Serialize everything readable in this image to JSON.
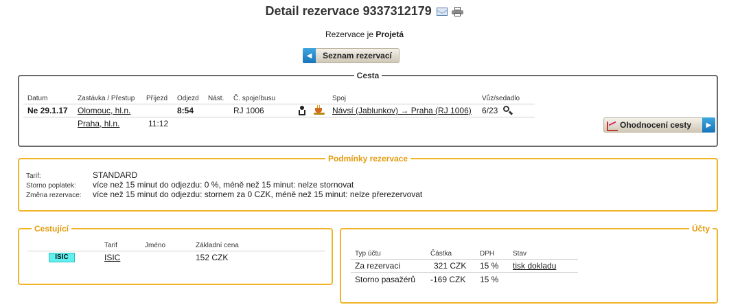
{
  "header": {
    "title": "Detail rezervace 9337312179",
    "mail_icon": "mail-icon",
    "print_icon": "print-icon"
  },
  "status": {
    "prefix": "Rezervace je",
    "value": "Projetá"
  },
  "buttons": {
    "list_label": "Seznam rezervací",
    "rating_label": "Ohodnocení cesty"
  },
  "cesta": {
    "legend": "Cesta",
    "headers": {
      "datum": "Datum",
      "zastavka": "Zastávka / Přestup",
      "prijezd": "Příjezd",
      "odjezd": "Odjezd",
      "nast": "Nást.",
      "spoj_cislo": "Č. spoje/busu",
      "spoj": "Spoj",
      "vuz": "Vůz/sedadlo"
    },
    "rows": [
      {
        "datum": "Ne 29.1.17",
        "zastavka": "Olomouc, hl.n.",
        "prijezd": "",
        "odjezd": "8:54",
        "nast": "",
        "spoj_cislo": "RJ 1006",
        "spoj": "Návsí (Jablunkov) → Praha (RJ 1006)",
        "vuz": "6/23"
      },
      {
        "datum": "",
        "zastavka": "Praha, hl.n.",
        "prijezd": "11:12",
        "odjezd": "",
        "nast": "",
        "spoj_cislo": "",
        "spoj": "",
        "vuz": ""
      }
    ]
  },
  "podminky": {
    "legend": "Podmínky rezervace",
    "tarif_label": "Tarif:",
    "tarif_value": "STANDARD",
    "storno_label": "Storno poplatek:",
    "storno_value": "více než 15 minut do odjezdu: 0 %, méně než 15 minut: nelze stornovat",
    "zmena_label": "Změna rezervace:",
    "zmena_value": "více než 15 minut do odjezdu: stornem za 0 CZK, méně než 15 minut: nelze přerezervovat"
  },
  "cestujici": {
    "legend": "Cestující",
    "headers": {
      "tarif": "Tarif",
      "jmeno": "Jméno",
      "cena": "Základní cena"
    },
    "rows": [
      {
        "badge": "ISIC",
        "tarif": "ISIC",
        "jmeno": "",
        "cena": "152 CZK"
      }
    ]
  },
  "ucty": {
    "legend": "Účty",
    "headers": {
      "typ": "Typ účtu",
      "castka": "Částka",
      "dph": "DPH",
      "stav": "Stav"
    },
    "rows": [
      {
        "typ": "Za rezervaci",
        "castka": "321 CZK",
        "dph": "15 %",
        "stav": "tisk dokladu"
      },
      {
        "typ": "Storno pasažérů",
        "castka": "-169 CZK",
        "dph": "15 %",
        "stav": ""
      }
    ]
  },
  "colors": {
    "accent_orange": "#f0b429",
    "legend_orange": "#e39a0a",
    "button_blue": "#1775b8",
    "isic_cyan": "#5ff0f0"
  }
}
